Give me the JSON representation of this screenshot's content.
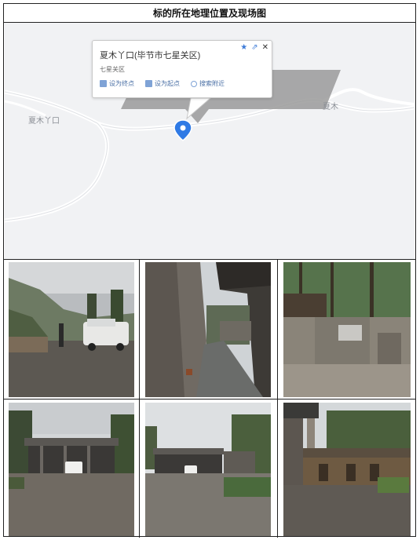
{
  "title": "标的所在地理位置及现场图",
  "map": {
    "popup": {
      "title": "夏木丫口(毕节市七星关区)",
      "subtitle": "七星关区",
      "actions": [
        "设为终点",
        "设为起点",
        "搜索附近"
      ]
    },
    "labels": {
      "left": "夏木丫口",
      "right": "夏木"
    },
    "colors": {
      "background": "#f1f2f4",
      "road": "#ffffff",
      "marker": "#2f7ae5"
    }
  },
  "photos": [
    {
      "name": "photo-yard-with-car"
    },
    {
      "name": "photo-alley-between-buildings"
    },
    {
      "name": "photo-dilapidated-sheds"
    },
    {
      "name": "photo-garage-shed-front"
    },
    {
      "name": "photo-garage-shed-wide"
    },
    {
      "name": "photo-house-with-plants"
    }
  ]
}
